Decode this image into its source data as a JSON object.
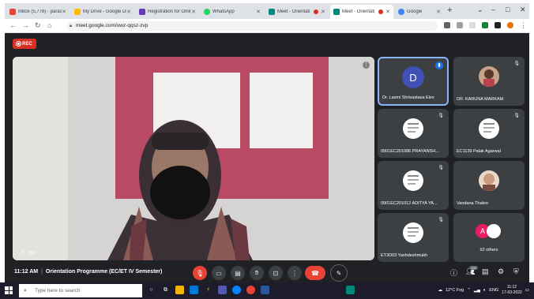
{
  "browser": {
    "tabs": [
      {
        "title": "Inbox (5,778) - paras",
        "favicon_color": "#ea4335",
        "active": false
      },
      {
        "title": "My Drive - Google Dr",
        "favicon_color": "#fbbc04",
        "active": false
      },
      {
        "title": "Registration for Onlin",
        "favicon_color": "#673ab7",
        "active": false
      },
      {
        "title": "WhatsApp",
        "favicon_color": "#25d366",
        "active": false
      },
      {
        "title": "Meet - Orientati",
        "favicon_color": "#00897b",
        "active": false
      },
      {
        "title": "Meet - Orientati",
        "favicon_color": "#00897b",
        "active": true
      },
      {
        "title": "Google",
        "favicon_color": "#4285f4",
        "active": false
      }
    ],
    "url": "meet.google.com/uwz-qqsz-zvp"
  },
  "meet": {
    "rec_label": "REC",
    "main_speaker_name": "You",
    "participants": [
      {
        "name": "Dr. Laxmi Shrivastava Elex",
        "avatar": "letter",
        "letter": "D",
        "speaking": true
      },
      {
        "name": "DR. KARUNA MARKAM",
        "avatar": "photo",
        "speaking": false
      },
      {
        "name": "0901EC201086 PRAYANSH...",
        "avatar": "document",
        "speaking": false
      },
      {
        "name": "EC1139 Palak Agarwal",
        "avatar": "document",
        "speaking": false
      },
      {
        "name": "0901EC201012 ADITYA YA...",
        "avatar": "document",
        "speaking": false
      },
      {
        "name": "Vandana Thakre",
        "avatar": "photo",
        "speaking": false
      },
      {
        "name": "ET3D03 Yashdeshmukh",
        "avatar": "document",
        "speaking": false
      }
    ],
    "others": {
      "letter": "A",
      "label": "92 others"
    },
    "time": "11:12 AM",
    "meeting_title": "Orientation Programme (EC/ET IV Semester)",
    "people_count": "100",
    "colors": {
      "accent_blue": "#8ab4f8",
      "end_call_red": "#ea4335",
      "bar_bg": "#202124",
      "tile_bg": "#3c4043"
    }
  },
  "taskbar": {
    "search_placeholder": "Type here to search",
    "weather": "12°C Fog",
    "language": "ENG",
    "clock_time": "11:12",
    "clock_date": "17-03-2022"
  }
}
